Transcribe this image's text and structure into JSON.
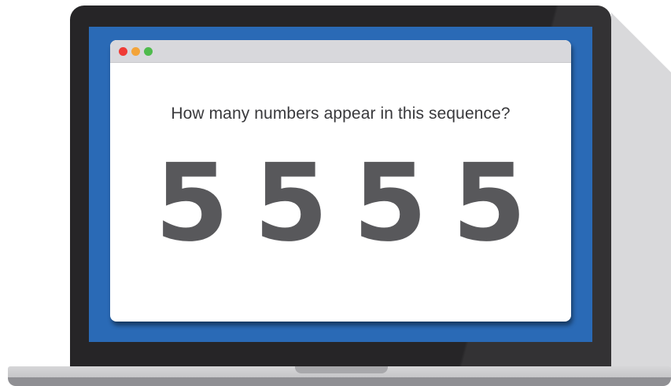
{
  "window": {
    "controls": {
      "close_color": "#ef3b36",
      "minimize_color": "#f3a43a",
      "maximize_color": "#4fbb4d"
    }
  },
  "content": {
    "question": "How many numbers appear in this sequence?",
    "digits": [
      "5",
      "5",
      "5",
      "5"
    ]
  },
  "colors": {
    "screen_background": "#2a6ab6",
    "laptop_bezel": "#262527",
    "digit_color": "#58585b",
    "text_color": "#39393c"
  }
}
